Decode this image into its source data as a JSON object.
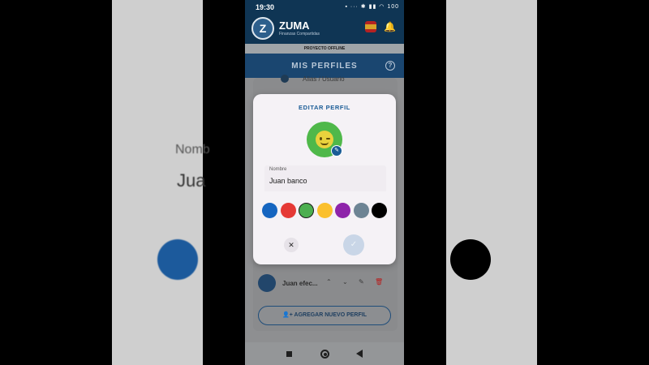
{
  "background": {
    "ghost_label": "Nomb",
    "ghost_value": "Jua",
    "left_circle_color": "#1c5a9c",
    "right_circle_color": "#000000"
  },
  "status_bar": {
    "time": "19:30",
    "icons_text": "▪ ··· ✱ ▮▮ ◠ 100"
  },
  "app_header": {
    "logo_letter": "Z",
    "app_name": "ZUMA",
    "app_subtitle": "Finanzas Compartidas",
    "flag_icon": "spain-flag-icon",
    "bell_glyph": "🔔"
  },
  "offline_banner": "PROYECTO OFFLINE",
  "section": {
    "title": "MIS PERFILES",
    "help_glyph": "?"
  },
  "underlying_list": {
    "top_row_text": "Alias / Usuario",
    "profile_name": "Juan efec...",
    "row_icons": [
      "⌃",
      "⌄",
      "✎",
      "🗑"
    ],
    "add_button_label": "AGREGAR NUEVO PERFIL",
    "add_button_glyph": "👤+"
  },
  "modal": {
    "title": "EDITAR PERFIL",
    "avatar_color": "#4fb84a",
    "avatar_emoji": "winking-face",
    "edit_glyph": "✎",
    "name_label": "Nombre",
    "name_value": "Juan banco",
    "colors": [
      {
        "name": "blue",
        "hex": "#1565c0",
        "selected": false
      },
      {
        "name": "red",
        "hex": "#e53935",
        "selected": false
      },
      {
        "name": "green",
        "hex": "#4caf50",
        "selected": true
      },
      {
        "name": "yellow",
        "hex": "#fbc02d",
        "selected": false
      },
      {
        "name": "purple",
        "hex": "#8e24aa",
        "selected": false
      },
      {
        "name": "gray",
        "hex": "#6d8494",
        "selected": false
      },
      {
        "name": "black",
        "hex": "#000000",
        "selected": false
      }
    ],
    "cancel_glyph": "✕",
    "confirm_glyph": "✓"
  },
  "nav_bar": {
    "buttons": [
      "recents",
      "home",
      "back"
    ]
  }
}
